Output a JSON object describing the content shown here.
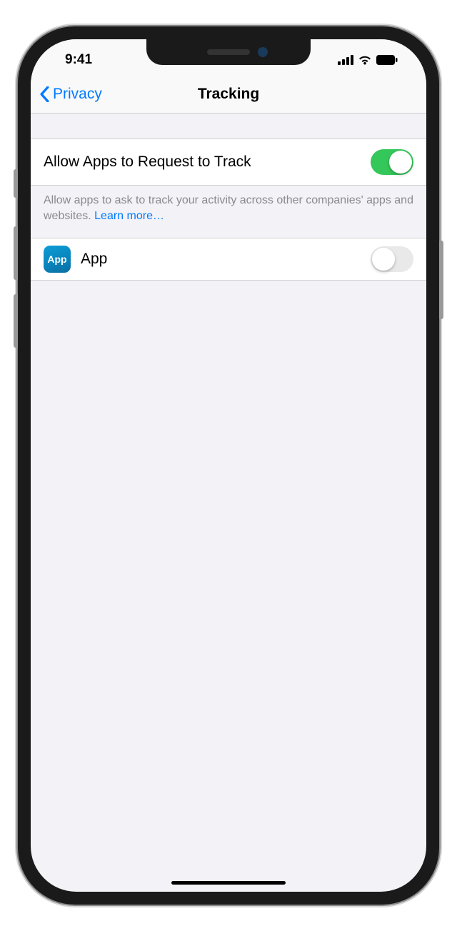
{
  "statusBar": {
    "time": "9:41"
  },
  "nav": {
    "backLabel": "Privacy",
    "title": "Tracking"
  },
  "settings": {
    "allowTracking": {
      "label": "Allow Apps to Request to Track",
      "enabled": true
    },
    "footerText": "Allow apps to ask to track your activity across other companies' apps and websites. ",
    "learnMore": "Learn more…"
  },
  "apps": [
    {
      "iconText": "App",
      "name": "App",
      "enabled": false
    }
  ]
}
